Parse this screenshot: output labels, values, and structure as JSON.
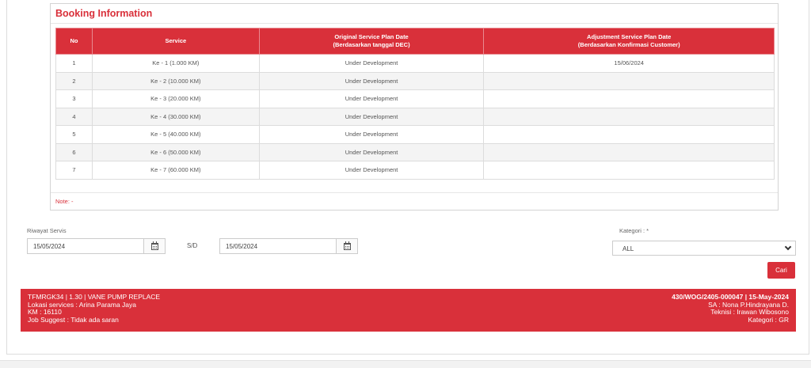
{
  "booking": {
    "title": "Booking Information",
    "headers": {
      "no": "No",
      "service": "Service",
      "original_line1": "Original Service Plan Date",
      "original_line2": "(Berdasarkan tanggal DEC)",
      "adjustment_line1": "Adjustment Service Plan Date",
      "adjustment_line2": "(Berdasarkan Konfirmasi Customer)"
    },
    "rows": [
      {
        "no": "1",
        "service": "Ke - 1 (1.000 KM)",
        "original": "Under Development",
        "adjustment": "15/06/2024"
      },
      {
        "no": "2",
        "service": "Ke - 2 (10.000 KM)",
        "original": "Under Development",
        "adjustment": ""
      },
      {
        "no": "3",
        "service": "Ke - 3 (20.000 KM)",
        "original": "Under Development",
        "adjustment": ""
      },
      {
        "no": "4",
        "service": "Ke - 4 (30.000 KM)",
        "original": "Under Development",
        "adjustment": ""
      },
      {
        "no": "5",
        "service": "Ke - 5 (40.000 KM)",
        "original": "Under Development",
        "adjustment": ""
      },
      {
        "no": "6",
        "service": "Ke - 6 (50.000 KM)",
        "original": "Under Development",
        "adjustment": ""
      },
      {
        "no": "7",
        "service": "Ke - 7 (60.000 KM)",
        "original": "Under Development",
        "adjustment": ""
      }
    ],
    "note": "Note: -"
  },
  "filter": {
    "riwayat_label": "Riwayat Servis",
    "date_from": "15/05/2024",
    "sd_label": "S/D",
    "date_to": "15/05/2024",
    "kategori_label": "Kategori : *",
    "kategori_value": "ALL",
    "cari_label": "Cari"
  },
  "info": {
    "left": [
      "TFMRGK34 | 1.30 | VANE PUMP REPLACE",
      "Lokasi services : Arina Parama Jaya",
      "KM : 16110",
      "Job Suggest : Tidak ada saran"
    ],
    "right": [
      "430/WOG/2405-000047 | 15-May-2024",
      "SA : Nona P.Hindrayana D.",
      "Teknisi : Irawan Wibosono",
      "Kategori : GR"
    ]
  },
  "colors": {
    "accent": "#d9303a"
  },
  "icons": {
    "calendar": "calendar-icon",
    "dropdown": "chevron-down-icon"
  }
}
